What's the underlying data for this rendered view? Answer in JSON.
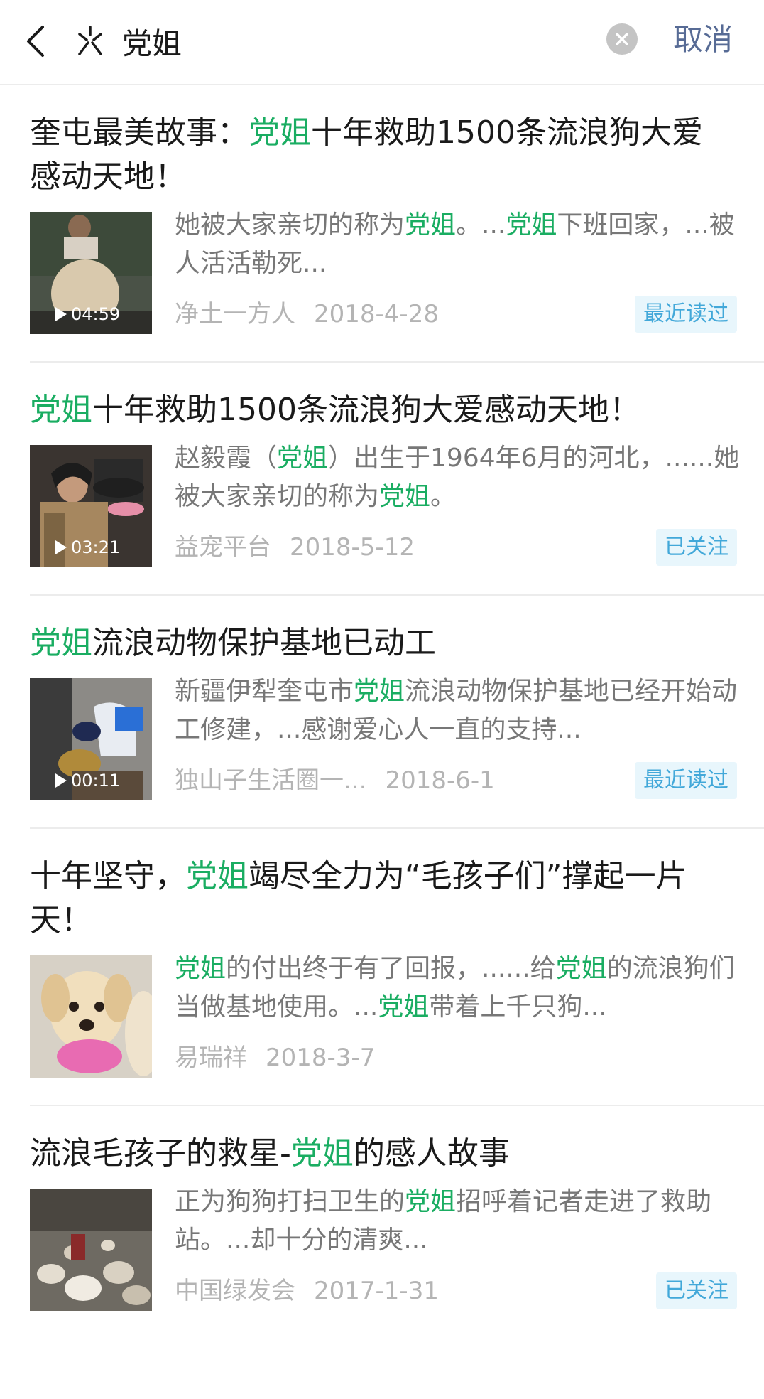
{
  "search": {
    "query": "党姐",
    "cancel_label": "取消",
    "icon_back": "chevron-left-icon",
    "icon_brand": "sparkle-icon",
    "icon_clear": "close-circle-icon"
  },
  "colors": {
    "highlight": "#1aad62",
    "cancel": "#576b95",
    "badge_bg": "#e8f6fc",
    "badge_text": "#42a8d9"
  },
  "results": [
    {
      "title_parts": [
        {
          "text": "奎屯最美故事：",
          "hl": false
        },
        {
          "text": "党姐",
          "hl": true
        },
        {
          "text": "十年救助1500条流浪狗大爱感动天地！",
          "hl": false
        }
      ],
      "snippet_parts": [
        {
          "text": "她被大家亲切的称为",
          "hl": false
        },
        {
          "text": "党姐",
          "hl": true
        },
        {
          "text": "。...",
          "hl": false
        },
        {
          "text": "党姐",
          "hl": true
        },
        {
          "text": "下班回家，...被人活活勒死...",
          "hl": false
        }
      ],
      "duration": "04:59",
      "source": "净土一方人",
      "date": "2018-4-28",
      "badge": "最近读过"
    },
    {
      "title_parts": [
        {
          "text": "党姐",
          "hl": true
        },
        {
          "text": "十年救助1500条流浪狗大爱感动天地！",
          "hl": false
        }
      ],
      "snippet_parts": [
        {
          "text": "赵毅霞（",
          "hl": false
        },
        {
          "text": "党姐",
          "hl": true
        },
        {
          "text": "）出生于1964年6月的河北，......她被大家亲切的称为",
          "hl": false
        },
        {
          "text": "党姐",
          "hl": true
        },
        {
          "text": "。",
          "hl": false
        }
      ],
      "duration": "03:21",
      "source": "益宠平台",
      "date": "2018-5-12",
      "badge": "已关注"
    },
    {
      "title_parts": [
        {
          "text": "党姐",
          "hl": true
        },
        {
          "text": "流浪动物保护基地已动工",
          "hl": false
        }
      ],
      "snippet_parts": [
        {
          "text": "新疆伊犁奎屯市",
          "hl": false
        },
        {
          "text": "党姐",
          "hl": true
        },
        {
          "text": "流浪动物保护基地已经开始动工修建，...感谢爱心人一直的支持...",
          "hl": false
        }
      ],
      "duration": "00:11",
      "source": "独山子生活圈一...",
      "date": "2018-6-1",
      "badge": "最近读过"
    },
    {
      "title_parts": [
        {
          "text": "十年坚守，",
          "hl": false
        },
        {
          "text": "党姐",
          "hl": true
        },
        {
          "text": "竭尽全力为“毛孩子们”撑起一片天！",
          "hl": false
        }
      ],
      "snippet_parts": [
        {
          "text": "党姐",
          "hl": true
        },
        {
          "text": "的付出终于有了回报，......给",
          "hl": false
        },
        {
          "text": "党姐",
          "hl": true
        },
        {
          "text": "的流浪狗们当做基地使用。...",
          "hl": false
        },
        {
          "text": "党姐",
          "hl": true
        },
        {
          "text": "带着上千只狗...",
          "hl": false
        }
      ],
      "duration": "",
      "source": "易瑞祥",
      "date": "2018-3-7",
      "badge": ""
    },
    {
      "title_parts": [
        {
          "text": "流浪毛孩子的救星-",
          "hl": false
        },
        {
          "text": "党姐",
          "hl": true
        },
        {
          "text": "的感人故事",
          "hl": false
        }
      ],
      "snippet_parts": [
        {
          "text": "正为狗狗打扫卫生的",
          "hl": false
        },
        {
          "text": "党姐",
          "hl": true
        },
        {
          "text": "招呼着记者走进了救助站。...却十分的清爽...",
          "hl": false
        }
      ],
      "duration": "",
      "source": "中国绿发会",
      "date": "2017-1-31",
      "badge": "已关注"
    }
  ]
}
